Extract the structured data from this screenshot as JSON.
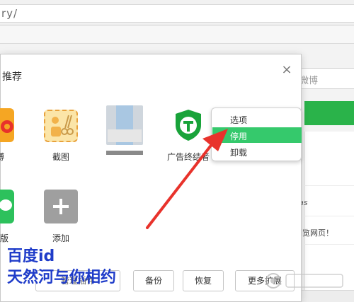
{
  "browser": {
    "address_text": "ry/"
  },
  "background": {
    "search_placeholder": "微博",
    "text1": "as",
    "text2": "浏览网页！"
  },
  "dialog": {
    "title": "推荐",
    "close_glyph": "×",
    "extensions": [
      {
        "label": "博"
      },
      {
        "label": "截图"
      },
      {
        "label": ""
      },
      {
        "label": "广告终结者"
      },
      {
        "label": "页版"
      },
      {
        "label": "添加"
      }
    ],
    "context_menu": [
      {
        "label": "选项"
      },
      {
        "label": "停用"
      },
      {
        "label": "卸载"
      }
    ],
    "buttons": {
      "backup": "备份",
      "restore": "恢复",
      "more": "更多扩展"
    },
    "partial_button": "管理插件"
  },
  "watermark": {
    "line1": "百度id",
    "line2": "天然河与你相约"
  },
  "colors": {
    "menu_highlight": "#35c96c",
    "accent_green": "#2ab34a",
    "arrow": "#e8322b",
    "watermark_blue": "#1f3cc9"
  }
}
